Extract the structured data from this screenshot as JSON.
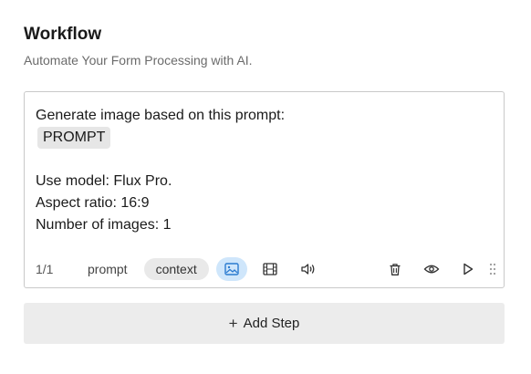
{
  "header": {
    "title": "Workflow",
    "subtitle": "Automate Your Form Processing with AI."
  },
  "step": {
    "lines": {
      "intro": "Generate image based on this prompt:",
      "variable": "PROMPT",
      "model": "Use model: Flux Pro.",
      "aspect": "Aspect ratio: 16:9",
      "count": "Number of images: 1"
    },
    "toolbar": {
      "counter": "1/1",
      "prompt_label": "prompt",
      "context_label": "context",
      "icons": [
        "image-icon",
        "film-icon",
        "speaker-icon",
        "trash-icon",
        "eye-icon",
        "play-icon",
        "drag-handle-icon"
      ],
      "active_icon": "image-icon"
    }
  },
  "actions": {
    "add_step_label": "Add Step",
    "add_step_icon": "plus-icon"
  },
  "colors": {
    "accent_active_bg": "#cfe6fb",
    "chip_bg": "#e6e6e6",
    "button_bg": "#ececec"
  }
}
